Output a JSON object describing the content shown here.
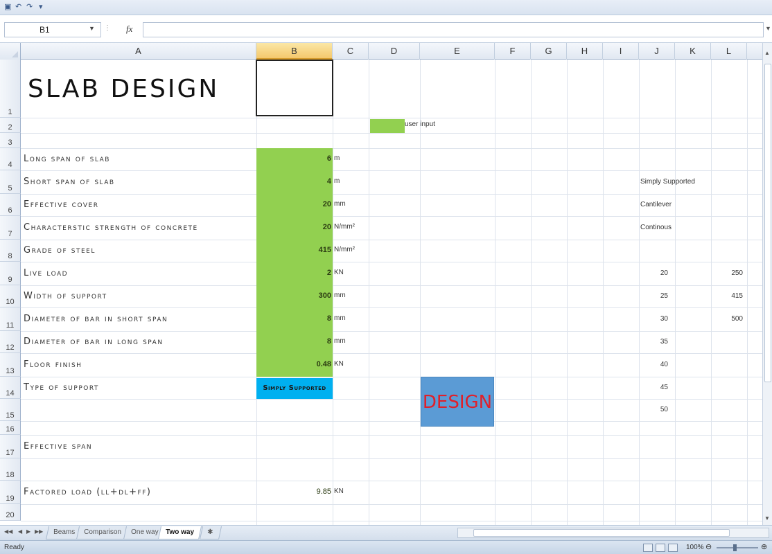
{
  "formula_bar": {
    "name_box": "B1",
    "fx": "fx",
    "formula": ""
  },
  "columns": [
    "A",
    "B",
    "C",
    "D",
    "E",
    "F",
    "G",
    "H",
    "I",
    "J",
    "K",
    "L"
  ],
  "selected_column": "B",
  "rows": [
    "1",
    "2",
    "3",
    "4",
    "5",
    "6",
    "7",
    "8",
    "9",
    "10",
    "11",
    "12",
    "13",
    "14",
    "15",
    "16",
    "17",
    "18",
    "19",
    "20"
  ],
  "sheet": {
    "title": "SLAB DESIGN",
    "legend": "user input",
    "inputs": [
      {
        "label": "Long span of slab",
        "value": "6",
        "unit": "m"
      },
      {
        "label": "Short span of slab",
        "value": "4",
        "unit": "m"
      },
      {
        "label": "Effective cover",
        "value": "20",
        "unit": "mm"
      },
      {
        "label": "Characterstic strength of concrete",
        "value": "20",
        "unit": "N/mm²"
      },
      {
        "label": "Grade of steel",
        "value": "415",
        "unit": "N/mm²"
      },
      {
        "label": "Live Load",
        "value": "2",
        "unit": "KN"
      },
      {
        "label": "Width of support",
        "value": "300",
        "unit": "mm"
      },
      {
        "label": "Diameter of bar in short span",
        "value": "8",
        "unit": "mm"
      },
      {
        "label": "Diameter of bar in long span",
        "value": "8",
        "unit": "mm"
      },
      {
        "label": "Floor Finish",
        "value": "0.48",
        "unit": "KN"
      }
    ],
    "type_of_support": {
      "label": "Type of Support",
      "value": "Simply Supported"
    },
    "design_button": "DESIGN",
    "effective_span_label": "Effective span",
    "factored_load": {
      "label": "Factored load (LL+DL+FF)",
      "value": "9.85",
      "unit": "KN"
    },
    "support_options": [
      "Simply Supported",
      "Cantilever",
      "Continous"
    ],
    "concrete_grades": [
      "20",
      "25",
      "30",
      "35",
      "40",
      "45",
      "50"
    ],
    "steel_grades": [
      "250",
      "415",
      "500"
    ]
  },
  "tabs": [
    "Beams",
    "Comparison",
    "One way",
    "Two way"
  ],
  "active_tab": "Two way",
  "status": {
    "text": "Ready",
    "zoom": "100%"
  },
  "colors": {
    "input_green": "#92d050",
    "support_blue": "#00b0f0",
    "button_blue": "#5b9bd5",
    "button_text_red": "#e0202a"
  }
}
